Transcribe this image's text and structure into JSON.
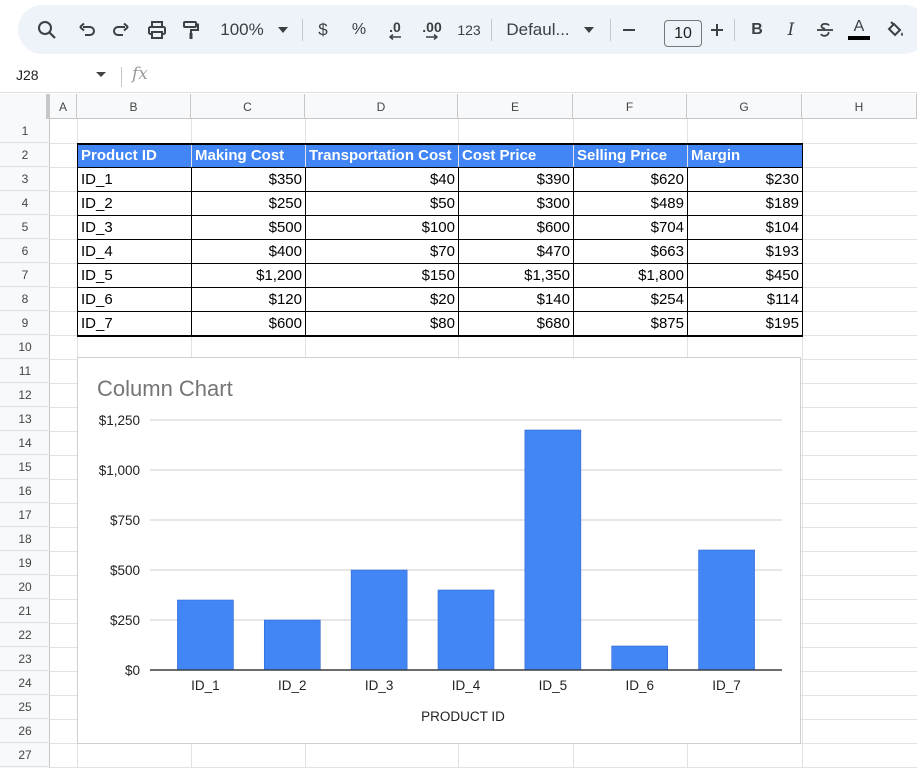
{
  "toolbar": {
    "zoom": "100%",
    "currency_symbol": "$",
    "percent_symbol": "%",
    "decrease_decimals": ".0",
    "increase_decimals": ".00",
    "number_format": "123",
    "font_name": "Defaul...",
    "font_size": "10",
    "bold": "B",
    "italic": "I",
    "text_color": "A",
    "icons": [
      "search-icon",
      "undo-icon",
      "redo-icon",
      "print-icon",
      "paint-format-icon",
      "chevron-down-icon",
      "minus-icon",
      "plus-icon",
      "strikethrough-icon",
      "fill-color-icon"
    ],
    "accent_color": "#4285f4"
  },
  "formula_bar": {
    "cell_ref": "J28",
    "fx": "fx",
    "value": ""
  },
  "columns": [
    "A",
    "B",
    "C",
    "D",
    "E",
    "F",
    "G",
    "H"
  ],
  "rows": [
    "1",
    "2",
    "3",
    "4",
    "5",
    "6",
    "7",
    "8",
    "9",
    "10",
    "11",
    "12",
    "13",
    "14",
    "15",
    "16",
    "17",
    "18",
    "19",
    "20",
    "21",
    "22",
    "23",
    "24",
    "25",
    "26",
    "27"
  ],
  "table": {
    "headers": [
      "Product ID",
      "Making Cost",
      "Transportation Cost",
      "Cost Price",
      "Selling Price",
      "Margin"
    ],
    "rows": [
      [
        "ID_1",
        "$350",
        "$40",
        "$390",
        "$620",
        "$230"
      ],
      [
        "ID_2",
        "$250",
        "$50",
        "$300",
        "$489",
        "$189"
      ],
      [
        "ID_3",
        "$500",
        "$100",
        "$600",
        "$704",
        "$104"
      ],
      [
        "ID_4",
        "$400",
        "$70",
        "$470",
        "$663",
        "$193"
      ],
      [
        "ID_5",
        "$1,200",
        "$150",
        "$1,350",
        "$1,800",
        "$450"
      ],
      [
        "ID_6",
        "$120",
        "$20",
        "$140",
        "$254",
        "$114"
      ],
      [
        "ID_7",
        "$600",
        "$80",
        "$680",
        "$875",
        "$195"
      ]
    ],
    "header_color": "#4285f4"
  },
  "chart_data": {
    "type": "bar",
    "title": "Column Chart",
    "xlabel": "PRODUCT ID",
    "ylabel": "",
    "categories": [
      "ID_1",
      "ID_2",
      "ID_3",
      "ID_4",
      "ID_5",
      "ID_6",
      "ID_7"
    ],
    "values": [
      350,
      250,
      500,
      400,
      1200,
      120,
      600
    ],
    "ylim": [
      0,
      1250
    ],
    "yticks": [
      0,
      250,
      500,
      750,
      1000,
      1250
    ],
    "ytick_labels": [
      "$0",
      "$250",
      "$500",
      "$750",
      "$1,000",
      "$1,250"
    ],
    "grid": true,
    "legend": "none",
    "bar_color": "#4285f4"
  }
}
